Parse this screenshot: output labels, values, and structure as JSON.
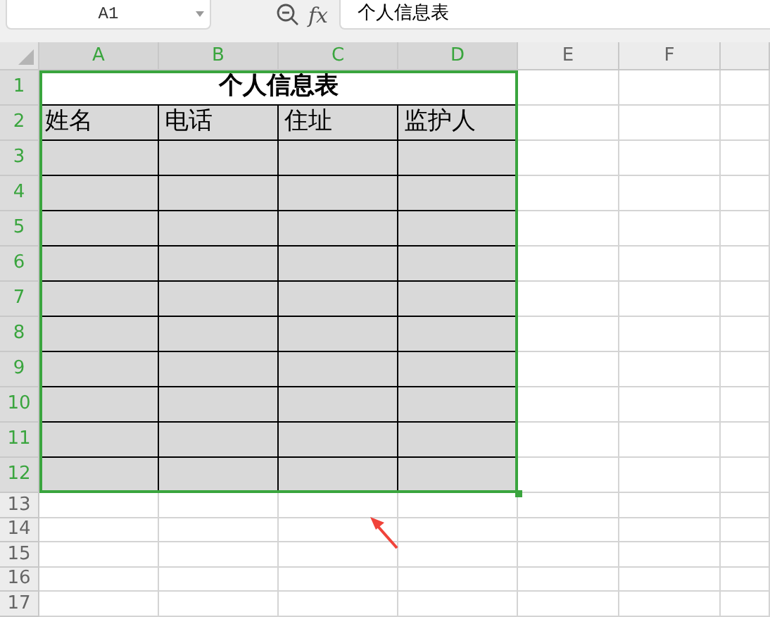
{
  "name_box": {
    "value": "A1"
  },
  "formula_bar": {
    "fx": "fx",
    "value": "个人信息表"
  },
  "columns": [
    {
      "label": "A",
      "selected": true
    },
    {
      "label": "B",
      "selected": true
    },
    {
      "label": "C",
      "selected": true
    },
    {
      "label": "D",
      "selected": true
    },
    {
      "label": "E",
      "selected": false
    },
    {
      "label": "F",
      "selected": false
    },
    {
      "selected": false
    }
  ],
  "table": {
    "title": "个人信息表",
    "headers": [
      "姓名",
      "电话",
      "住址",
      "监护人"
    ]
  },
  "rows": [
    {
      "label": "1",
      "selected": true,
      "kind": "title"
    },
    {
      "label": "2",
      "selected": true,
      "kind": "header"
    },
    {
      "label": "3",
      "selected": true,
      "kind": "blank"
    },
    {
      "label": "4",
      "selected": true,
      "kind": "blank"
    },
    {
      "label": "5",
      "selected": true,
      "kind": "blank"
    },
    {
      "label": "6",
      "selected": true,
      "kind": "blank"
    },
    {
      "label": "7",
      "selected": true,
      "kind": "blank"
    },
    {
      "label": "8",
      "selected": true,
      "kind": "blank"
    },
    {
      "label": "9",
      "selected": true,
      "kind": "blank"
    },
    {
      "label": "10",
      "selected": true,
      "kind": "blank"
    },
    {
      "label": "11",
      "selected": true,
      "kind": "blank"
    },
    {
      "label": "12",
      "selected": true,
      "kind": "blank"
    },
    {
      "label": "13",
      "selected": false,
      "kind": "empty"
    },
    {
      "label": "14",
      "selected": false,
      "kind": "empty"
    },
    {
      "label": "15",
      "selected": false,
      "kind": "empty"
    },
    {
      "label": "16",
      "selected": false,
      "kind": "empty"
    },
    {
      "label": "17",
      "selected": false,
      "kind": "empty"
    }
  ]
}
